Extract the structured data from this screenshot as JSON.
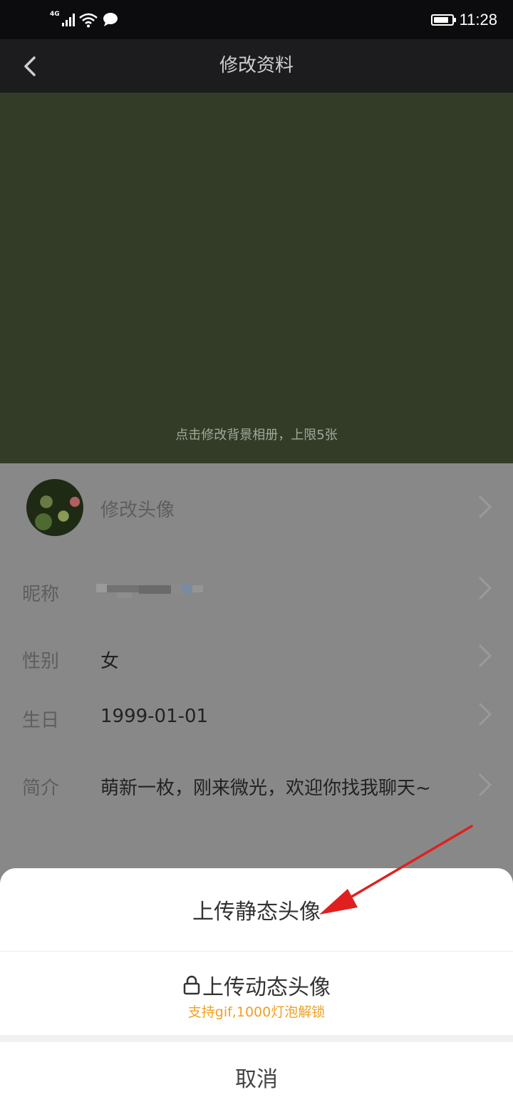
{
  "status_bar": {
    "network": "4G",
    "time": "11:28",
    "icons": [
      "signal-icon",
      "wifi-icon",
      "message-icon",
      "battery-icon"
    ],
    "battery_level": 0.85
  },
  "nav": {
    "back_icon": "chevron-left-icon",
    "title": "修改资料"
  },
  "background_album": {
    "hint": "点击修改背景相册，上限5张"
  },
  "profile": {
    "avatar_label": "修改头像",
    "rows": [
      {
        "label": "昵称",
        "value": ""
      },
      {
        "label": "性别",
        "value": "女"
      },
      {
        "label": "生日",
        "value": "1999-01-01"
      },
      {
        "label": "简介",
        "value": "萌新一枚，刚来微光，欢迎你找我聊天~"
      }
    ]
  },
  "action_sheet": {
    "upload_static": "上传静态头像",
    "upload_animated": "上传动态头像",
    "upload_animated_note": "支持gif,1000灯泡解锁",
    "cancel": "取消",
    "note_color": "#f0a020"
  },
  "annotation": {
    "arrow_color": "#e02020"
  }
}
